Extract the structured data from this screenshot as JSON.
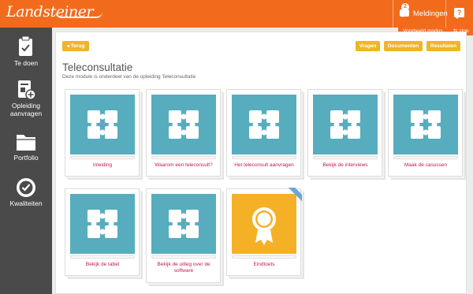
{
  "header": {
    "logo_text": "Landsteiner",
    "messages_label": "Meldingen",
    "messages_count": "2",
    "help_symbol": "?",
    "demo_mode_label": "Voorbeeld modus",
    "stop_label": "stop"
  },
  "sidebar": {
    "items": [
      {
        "label": "Te doen",
        "icon": "clipboard-icon"
      },
      {
        "label": "Opleiding aanvragen",
        "icon": "add-course-icon"
      },
      {
        "label": "Portfolio",
        "icon": "folder-icon"
      },
      {
        "label": "Kwaliteiten",
        "icon": "badge-check-icon"
      }
    ]
  },
  "toolbar": {
    "back_label": "◂ Terug",
    "questions_label": "Vragen",
    "documents_label": "Documenten",
    "results_label": "Resultaten"
  },
  "page": {
    "title": "Teleconsultatie",
    "subtitle": "Deze module is onderdeel van de opleiding Teleconsultatie"
  },
  "cards": [
    {
      "title": "Inleiding",
      "icon": "puzzle-icon"
    },
    {
      "title": "Waarom een teleconsult?",
      "icon": "puzzle-icon"
    },
    {
      "title": "Het teleconsult aanvragen",
      "icon": "puzzle-icon"
    },
    {
      "title": "Bekijk de interviews",
      "icon": "puzzle-icon"
    },
    {
      "title": "Maak de casussen",
      "icon": "puzzle-icon"
    },
    {
      "title": "Bekijk de tabel",
      "icon": "puzzle-icon"
    },
    {
      "title": "Bekijk de uitleg over de software",
      "icon": "puzzle-icon"
    },
    {
      "title": "Eindtoets",
      "icon": "award-ribbon-icon"
    }
  ],
  "colors": {
    "brand_orange": "#f26b1d",
    "sidebar": "#4a4a4a",
    "button_yellow": "#f0b428",
    "puzzle_teal": "#57adbe",
    "award_yellow": "#f5b125",
    "link_red": "#c21a4d"
  }
}
